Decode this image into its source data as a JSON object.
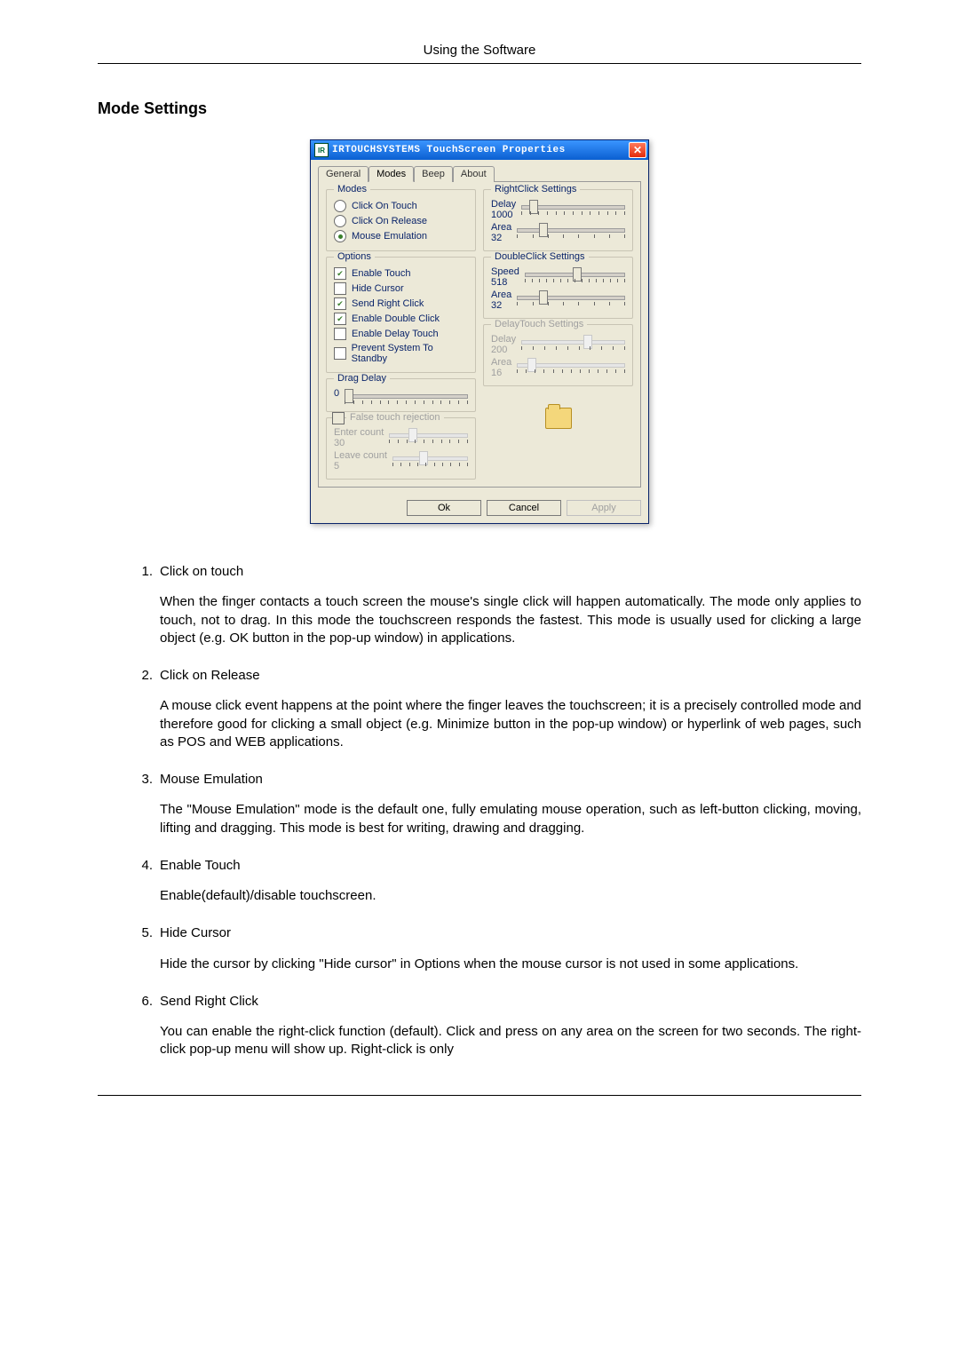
{
  "page": {
    "header": "Using the Software",
    "section_title": "Mode Settings"
  },
  "dialog": {
    "title": "IRTOUCHSYSTEMS TouchScreen Properties",
    "tabs": [
      "General",
      "Modes",
      "Beep",
      "About"
    ],
    "active_tab": 1,
    "modes_group": {
      "legend": "Modes",
      "options": [
        "Click On Touch",
        "Click On Release",
        "Mouse Emulation"
      ],
      "selected": 2
    },
    "options_group": {
      "legend": "Options",
      "items": [
        {
          "label": "Enable Touch",
          "checked": true
        },
        {
          "label": "Hide Cursor",
          "checked": false
        },
        {
          "label": "Send Right Click",
          "checked": true
        },
        {
          "label": "Enable Double Click",
          "checked": true
        },
        {
          "label": "Enable Delay Touch",
          "checked": false
        },
        {
          "label": "Prevent System To Standby",
          "checked": false
        }
      ]
    },
    "drag_delay": {
      "legend": "Drag Delay",
      "value": "0"
    },
    "false_touch": {
      "legend": "False touch rejection",
      "checked": false,
      "enter_label": "Enter count",
      "enter_value": "30",
      "leave_label": "Leave count",
      "leave_value": "5"
    },
    "rightclick": {
      "legend": "RightClick Settings",
      "delay_label": "Delay",
      "delay_value": "1000",
      "area_label": "Area",
      "area_value": "32"
    },
    "doubleclick": {
      "legend": "DoubleClick Settings",
      "speed_label": "Speed",
      "speed_value": "518",
      "area_label": "Area",
      "area_value": "32"
    },
    "delaytouch": {
      "legend": "DelayTouch Settings",
      "delay_label": "Delay",
      "delay_value": "200",
      "area_label": "Area",
      "area_value": "16"
    },
    "buttons": {
      "ok": "Ok",
      "cancel": "Cancel",
      "apply": "Apply"
    }
  },
  "list": [
    {
      "title": "Click on touch",
      "body": "When the finger contacts a touch screen the mouse's single click will happen automatically. The mode only applies to touch, not to drag. In this mode the touchscreen responds the fastest. This mode is usually used for clicking a large object (e.g. OK button in the pop-up window) in applications."
    },
    {
      "title": "Click on Release",
      "body": "A mouse click event happens at the point where the finger leaves the touchscreen; it is a precisely controlled mode and therefore good for clicking a small object (e.g. Minimize button in the pop-up window) or hyperlink of web pages, such as POS and WEB applications."
    },
    {
      "title": "Mouse Emulation",
      "body": "The \"Mouse Emulation\" mode is the default one, fully emulating mouse operation, such as left-button clicking, moving, lifting and dragging. This mode is best for writing, drawing and dragging."
    },
    {
      "title": "Enable Touch",
      "body": "Enable(default)/disable touchscreen."
    },
    {
      "title": "Hide Cursor",
      "body": "Hide the cursor by clicking \"Hide cursor\" in Options when the mouse cursor is not used in some applications."
    },
    {
      "title": "Send Right Click",
      "body": "You can enable the right-click function (default). Click and press on any area on the screen for two seconds. The right-click pop-up menu will show up. Right-click is only"
    }
  ]
}
